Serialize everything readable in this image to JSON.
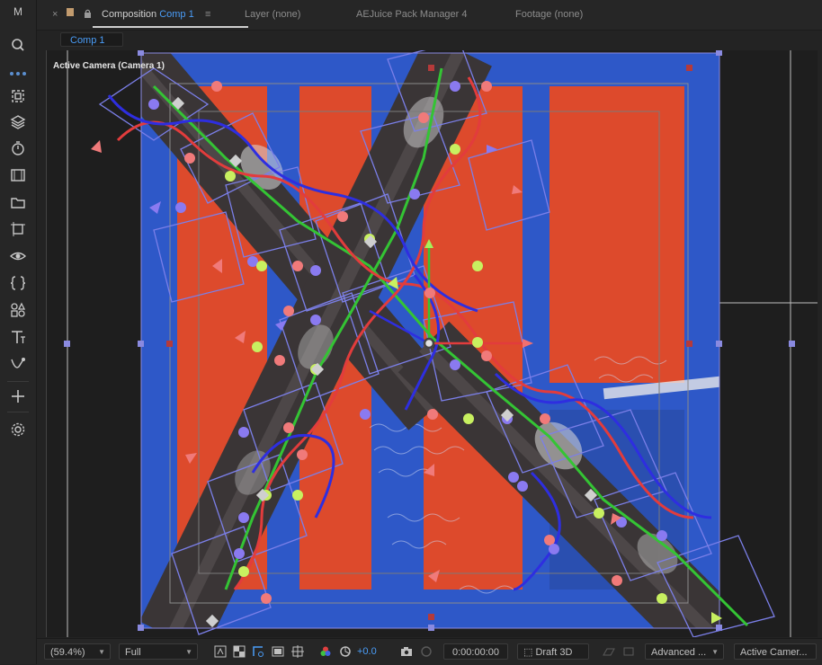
{
  "sidebar": {
    "logo": "M",
    "icons": [
      "search-icon",
      "crop-icon",
      "layers-icon",
      "timer-icon",
      "film-icon",
      "folder-icon",
      "artboard-icon",
      "eye-icon",
      "braces-icon",
      "shapes-icon",
      "text-icon",
      "path-icon",
      "plus-icon",
      "settings-icon"
    ]
  },
  "tabs": [
    {
      "label": "Composition",
      "name": "Comp 1",
      "active": true
    },
    {
      "label": "Layer",
      "value": "(none)"
    },
    {
      "label": "AEJuice Pack Manager 4"
    },
    {
      "label": "Footage",
      "value": "(none)"
    }
  ],
  "subbar": {
    "comp_pill": "Comp 1"
  },
  "viewer": {
    "camera_label": "Active Camera (Camera 1)",
    "colors": {
      "blue": "#2e58c8",
      "red": "#dd4a2c",
      "handle": "#8c8ef0",
      "chain": "#3a3536"
    }
  },
  "bottombar": {
    "zoom": "(59.4%)",
    "resolution": "Full",
    "exposure": "+0.0",
    "timecode": "0:00:00:00",
    "renderer": "Draft 3D",
    "view_options": "Advanced ...",
    "camera": "Active Camer..."
  }
}
